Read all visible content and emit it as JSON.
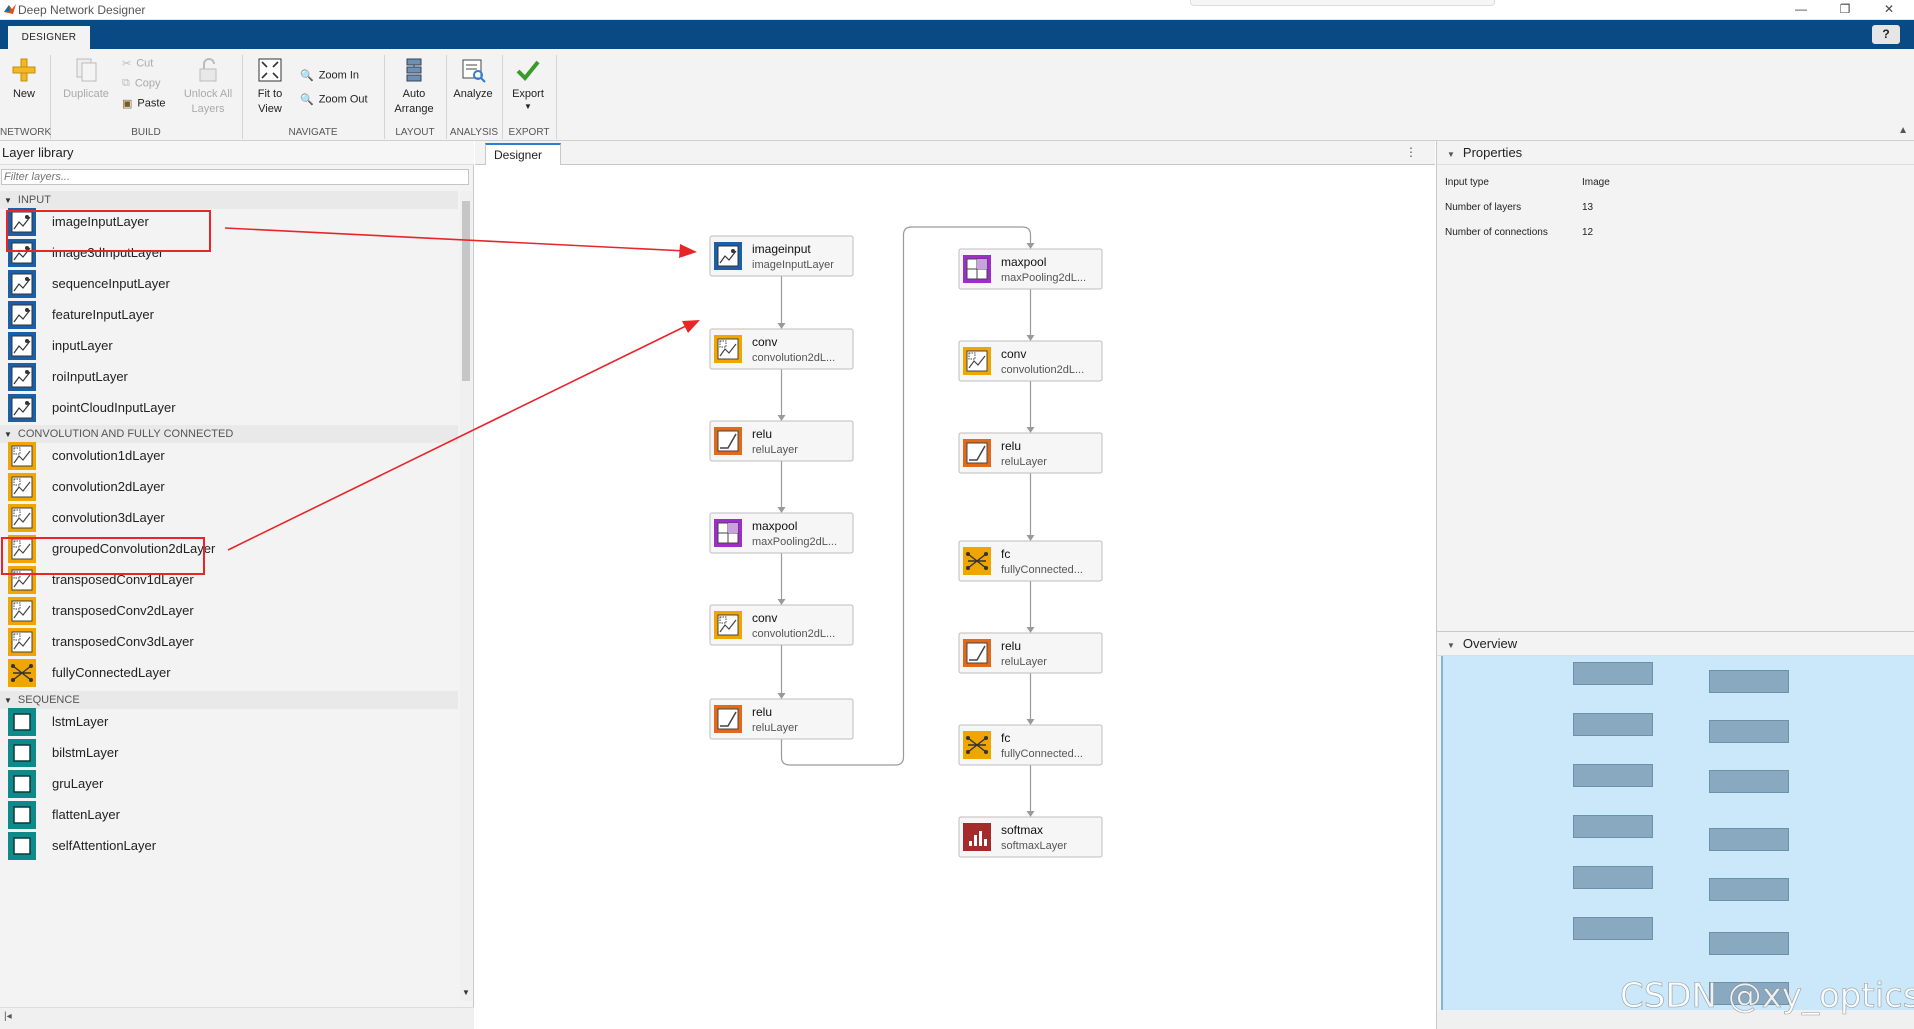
{
  "window": {
    "title": "Deep Network Designer"
  },
  "ribbon": {
    "tab": "DESIGNER",
    "help": "?",
    "buttons": {
      "new": "New",
      "duplicate": "Duplicate",
      "cut": "Cut",
      "copy": "Copy",
      "paste": "Paste",
      "unlock": "Unlock All Layers",
      "fit": "Fit to View",
      "zoom_in": "Zoom In",
      "zoom_out": "Zoom Out",
      "auto_arrange": "Auto Arrange",
      "analyze": "Analyze",
      "export": "Export"
    },
    "sections": [
      "NETWORK",
      "BUILD",
      "NAVIGATE",
      "LAYOUT",
      "ANALYSIS",
      "EXPORT"
    ]
  },
  "library": {
    "title": "Layer library",
    "filter_placeholder": "Filter layers...",
    "categories": [
      {
        "name": "INPUT",
        "items": [
          "imageInputLayer",
          "image3dInputLayer",
          "sequenceInputLayer",
          "featureInputLayer",
          "inputLayer",
          "roiInputLayer",
          "pointCloudInputLayer"
        ]
      },
      {
        "name": "CONVOLUTION AND FULLY CONNECTED",
        "items": [
          "convolution1dLayer",
          "convolution2dLayer",
          "convolution3dLayer",
          "groupedConvolution2dLayer",
          "transposedConv1dLayer",
          "transposedConv2dLayer",
          "transposedConv3dLayer",
          "fullyConnectedLayer"
        ]
      },
      {
        "name": "SEQUENCE",
        "items": [
          "lstmLayer",
          "bilstmLayer",
          "gruLayer",
          "flattenLayer",
          "selfAttentionLayer"
        ]
      }
    ]
  },
  "designer": {
    "tab": "Designer",
    "menu": "⋮",
    "nodes": [
      {
        "name": "imageinput",
        "type": "imageInputLayer",
        "kind": "input"
      },
      {
        "name": "conv",
        "type": "convolution2dL...",
        "kind": "conv"
      },
      {
        "name": "relu",
        "type": "reluLayer",
        "kind": "relu"
      },
      {
        "name": "maxpool",
        "type": "maxPooling2dL...",
        "kind": "pool"
      },
      {
        "name": "conv",
        "type": "convolution2dL...",
        "kind": "conv"
      },
      {
        "name": "relu",
        "type": "reluLayer",
        "kind": "relu"
      },
      {
        "name": "maxpool",
        "type": "maxPooling2dL...",
        "kind": "pool"
      },
      {
        "name": "conv",
        "type": "convolution2dL...",
        "kind": "conv"
      },
      {
        "name": "relu",
        "type": "reluLayer",
        "kind": "relu"
      },
      {
        "name": "fc",
        "type": "fullyConnected...",
        "kind": "fc"
      },
      {
        "name": "relu",
        "type": "reluLayer",
        "kind": "relu"
      },
      {
        "name": "fc",
        "type": "fullyConnected...",
        "kind": "fc"
      },
      {
        "name": "softmax",
        "type": "softmaxLayer",
        "kind": "softmax"
      }
    ]
  },
  "properties": {
    "title": "Properties",
    "rows": [
      {
        "key": "Input type",
        "value": "Image"
      },
      {
        "key": "Number of layers",
        "value": "13"
      },
      {
        "key": "Number of connections",
        "value": "12"
      }
    ]
  },
  "overview": {
    "title": "Overview"
  },
  "watermark": "CSDN @xy_optics",
  "colors": {
    "accent": "#0a4a84",
    "highlight": "#e8262a",
    "input": "#1a5fa8",
    "conv": "#f0a500",
    "relu": "#e06a1a",
    "pool": "#9b2fc7",
    "softmax": "#a52a2a",
    "sequence": "#0f8a8a"
  }
}
